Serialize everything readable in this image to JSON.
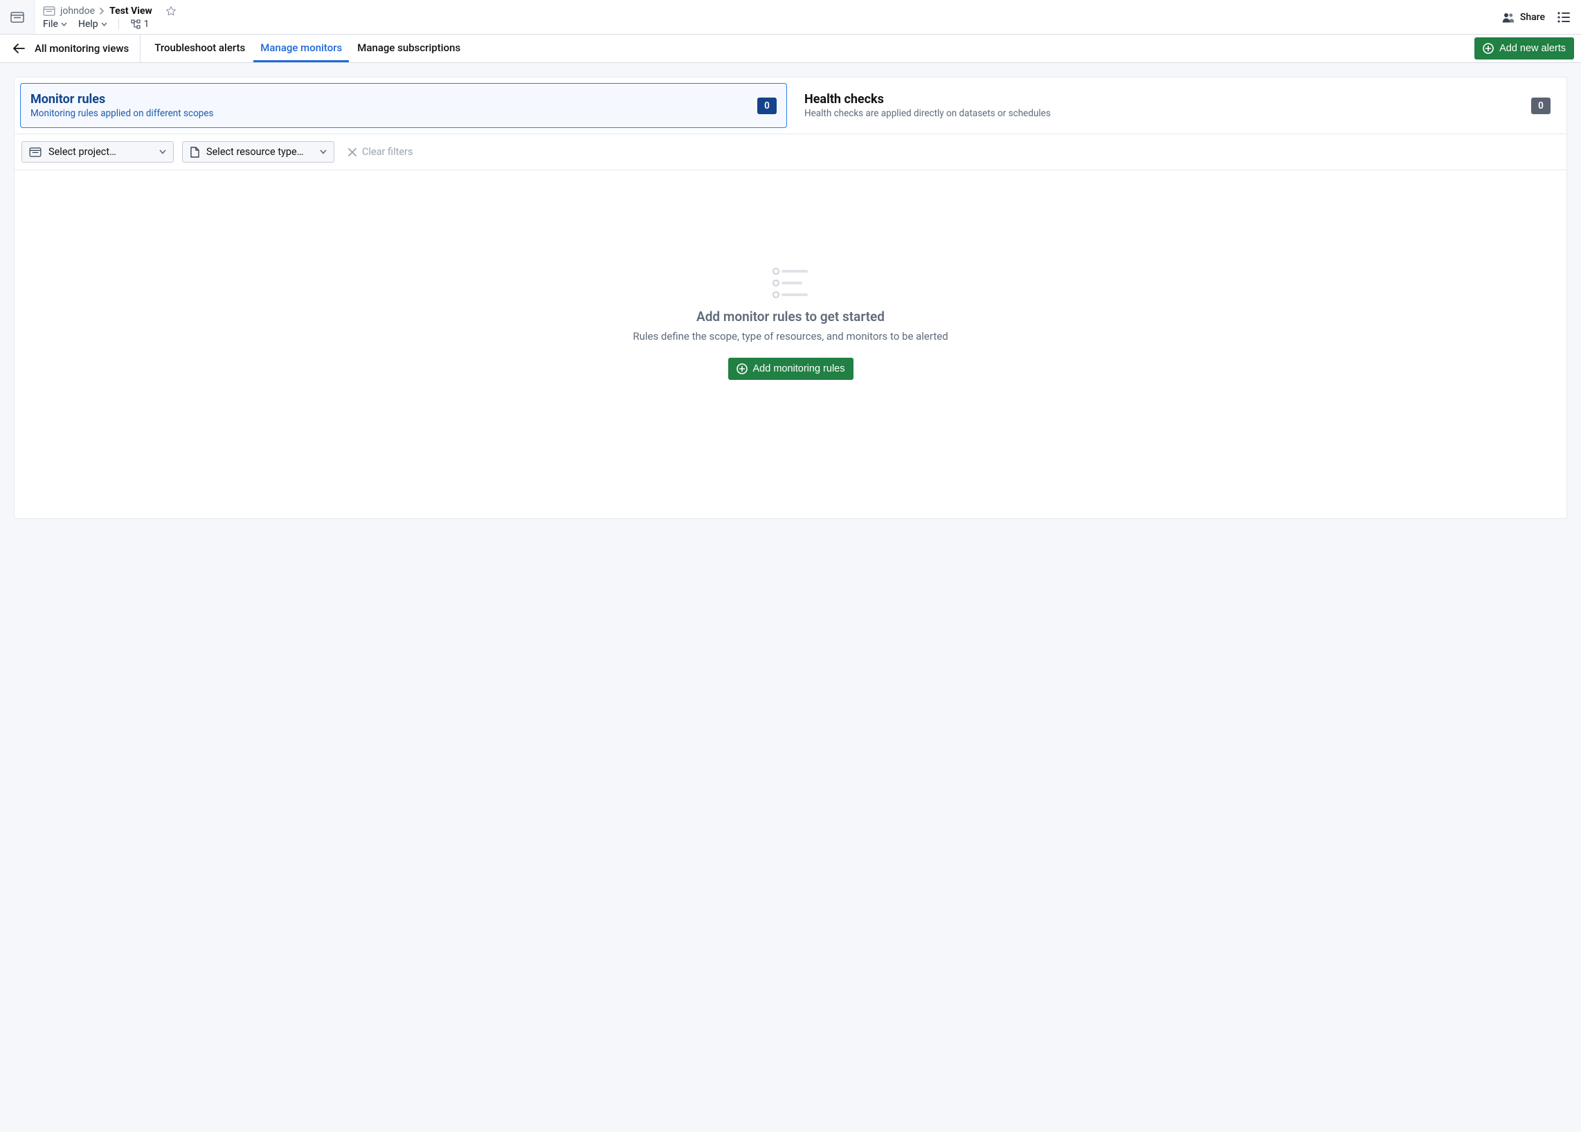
{
  "header": {
    "breadcrumb": {
      "folder": "johndoe",
      "title": "Test View"
    },
    "menus": {
      "file": "File",
      "help": "Help"
    },
    "branch_count": "1",
    "share_label": "Share"
  },
  "subnav": {
    "back_label": "All monitoring views",
    "tabs": [
      {
        "id": "troubleshoot",
        "label": "Troubleshoot alerts",
        "active": false
      },
      {
        "id": "manage-monitors",
        "label": "Manage monitors",
        "active": true
      },
      {
        "id": "manage-subscriptions",
        "label": "Manage subscriptions",
        "active": false
      }
    ],
    "add_alerts_label": "Add new alerts"
  },
  "cards": {
    "monitor_rules": {
      "title": "Monitor rules",
      "desc": "Monitoring rules applied on different scopes",
      "count": "0"
    },
    "health_checks": {
      "title": "Health checks",
      "desc": "Health checks are applied directly on datasets or schedules",
      "count": "0"
    }
  },
  "filters": {
    "project_placeholder": "Select project…",
    "resource_placeholder": "Select resource type…",
    "clear_label": "Clear filters"
  },
  "empty": {
    "title": "Add monitor rules to get started",
    "desc": "Rules define the scope, type of resources, and monitors to be alerted",
    "cta": "Add monitoring rules"
  }
}
